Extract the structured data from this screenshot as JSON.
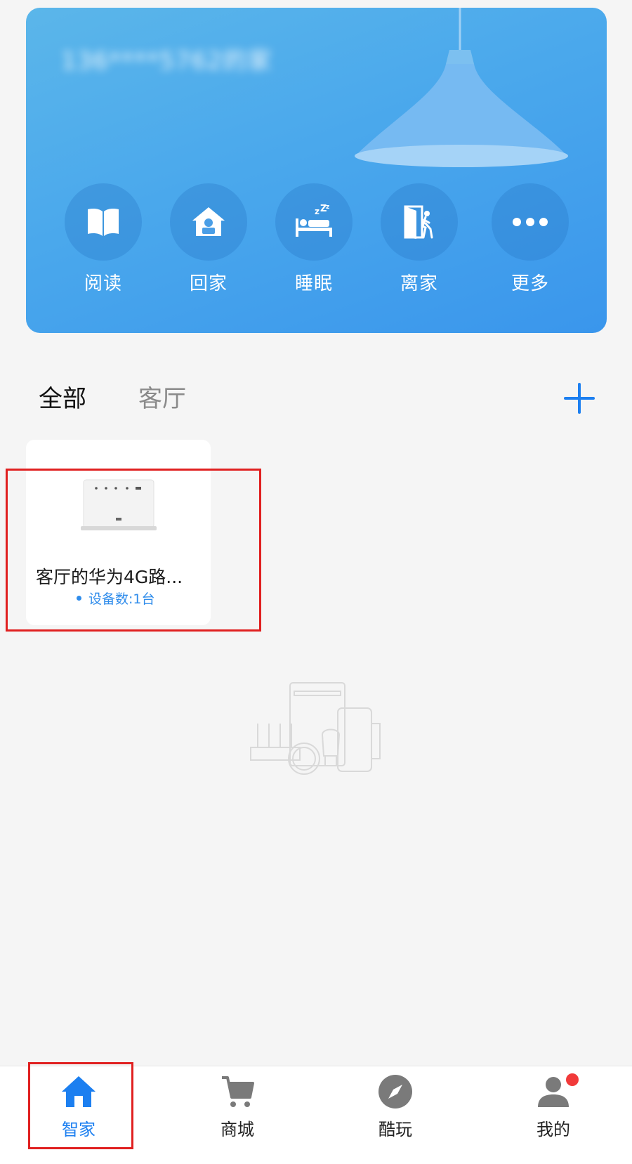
{
  "banner": {
    "home_name": "136****5762的家",
    "scenes": [
      {
        "label": "阅读",
        "icon": "book-icon"
      },
      {
        "label": "回家",
        "icon": "home-lock-icon"
      },
      {
        "label": "睡眠",
        "icon": "sleep-bed-icon"
      },
      {
        "label": "离家",
        "icon": "leave-door-icon"
      },
      {
        "label": "更多",
        "icon": "more-dots-icon"
      }
    ]
  },
  "tabs": [
    {
      "label": "全部",
      "active": true
    },
    {
      "label": "客厅",
      "active": false
    }
  ],
  "add_icon": "plus-icon",
  "device": {
    "name": "客厅的华为4G路...",
    "status": "设备数:1台",
    "image": "router-icon"
  },
  "nav": [
    {
      "label": "智家",
      "icon": "home-icon",
      "active": true
    },
    {
      "label": "商城",
      "icon": "cart-icon",
      "active": false
    },
    {
      "label": "酷玩",
      "icon": "compass-icon",
      "active": false
    },
    {
      "label": "我的",
      "icon": "user-icon",
      "active": false,
      "badge": true
    }
  ],
  "colors": {
    "accent": "#1c7ff0",
    "banner_start": "#5bb6ea",
    "banner_end": "#3a96ec",
    "highlight": "#e02020",
    "badge": "#f13a3a"
  }
}
